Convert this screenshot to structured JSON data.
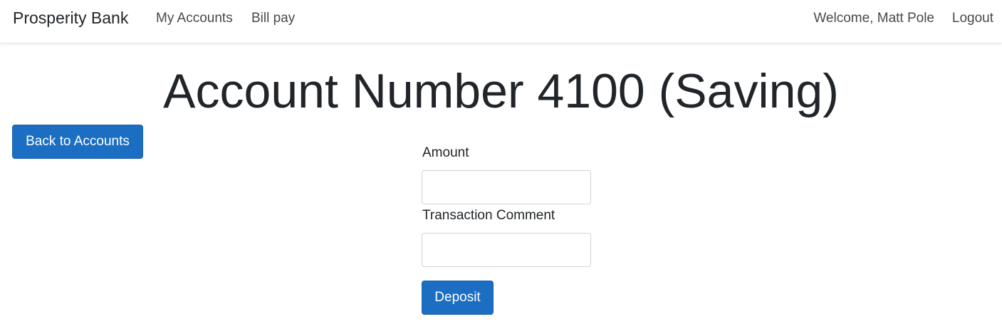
{
  "navbar": {
    "brand": "Prosperity Bank",
    "links": {
      "my_accounts": "My Accounts",
      "bill_pay": "Bill pay"
    },
    "welcome": "Welcome, Matt Pole",
    "logout": "Logout"
  },
  "page": {
    "title": "Account Number 4100 (Saving)",
    "back_button": "Back to Accounts"
  },
  "form": {
    "amount_label": "Amount",
    "amount_value": "",
    "comment_label": "Transaction Comment",
    "comment_value": "",
    "submit_label": "Deposit"
  },
  "colors": {
    "primary": "#1b6ec2",
    "text": "#212529"
  }
}
